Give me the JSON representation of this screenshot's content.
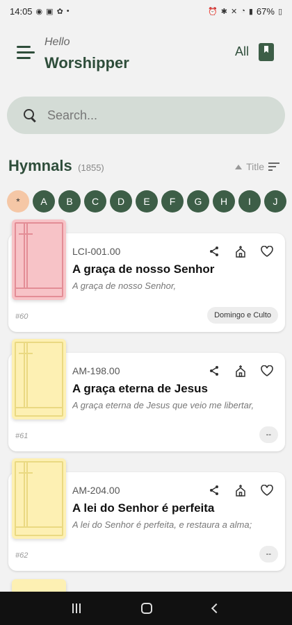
{
  "status": {
    "time": "14:05",
    "battery": "67%"
  },
  "header": {
    "greeting": "Hello",
    "user": "Worshipper",
    "filter_label": "All"
  },
  "search": {
    "placeholder": "Search..."
  },
  "section": {
    "title": "Hymnals",
    "count": "(1855)",
    "sort_label": "Title"
  },
  "alphabet": [
    "*",
    "A",
    "B",
    "C",
    "D",
    "E",
    "F",
    "G",
    "H",
    "I",
    "J"
  ],
  "hymns": [
    {
      "code": "LCI-001.00",
      "title": "A graça de nosso Senhor",
      "excerpt": "A graça de nosso Senhor,",
      "number": "#60",
      "tag": "Domingo e Culto",
      "color": "#f7c3c7"
    },
    {
      "code": "AM-198.00",
      "title": "A graça eterna de Jesus",
      "excerpt": "A graça eterna de Jesus que veio me libertar,",
      "number": "#61",
      "tag": "--",
      "color": "#fdf0b3"
    },
    {
      "code": "AM-204.00",
      "title": "A lei do Senhor é perfeita",
      "excerpt": "A lei do Senhor é perfeita, e restaura a alma;",
      "number": "#62",
      "tag": "--",
      "color": "#fdf0b3"
    }
  ]
}
